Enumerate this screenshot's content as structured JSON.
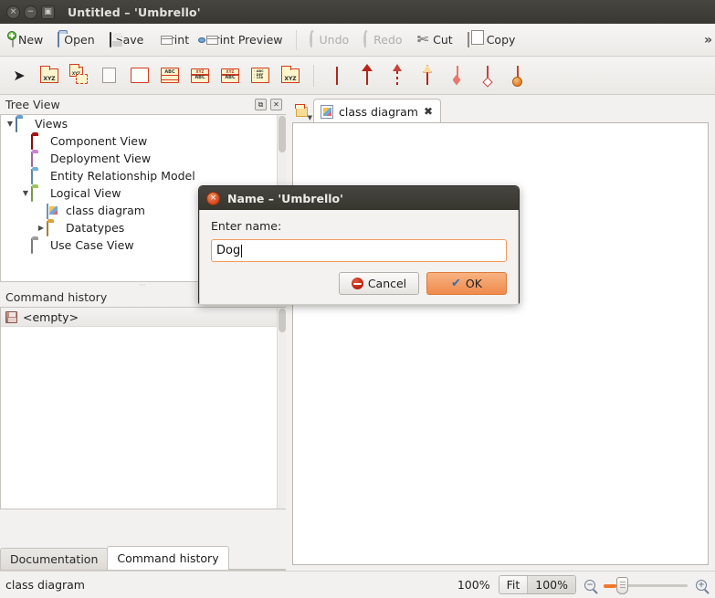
{
  "window": {
    "title": "Untitled – 'Umbrello'",
    "buttons": [
      {
        "name": "close",
        "glyph": "×"
      },
      {
        "name": "minimize",
        "glyph": "−"
      },
      {
        "name": "maximize",
        "glyph": "▣"
      }
    ]
  },
  "toolbar": {
    "items": [
      {
        "label": "New",
        "icon": "new-document-icon",
        "enabled": true
      },
      {
        "label": "Open",
        "icon": "open-folder-icon",
        "enabled": true
      },
      {
        "label": "Save",
        "icon": "floppy-disk-icon",
        "enabled": true
      },
      {
        "label": "Print",
        "icon": "printer-icon",
        "enabled": true
      },
      {
        "label": "Print Preview",
        "icon": "print-preview-icon",
        "enabled": true
      },
      {
        "label": "Undo",
        "icon": "undo-arrow-icon",
        "enabled": false
      },
      {
        "label": "Redo",
        "icon": "redo-arrow-icon",
        "enabled": false
      },
      {
        "label": "Cut",
        "icon": "scissors-icon",
        "enabled": true
      },
      {
        "label": "Copy",
        "icon": "copy-pages-icon",
        "enabled": true
      }
    ],
    "overflow_glyph": "»"
  },
  "uml_toolbar": {
    "items": [
      {
        "name": "select-tool",
        "kind": "cursor"
      },
      {
        "name": "class-tool",
        "kind": "box-fold",
        "text": "XYZ"
      },
      {
        "name": "package-tool",
        "kind": "package"
      },
      {
        "name": "note-tool",
        "kind": "note"
      },
      {
        "name": "box-tool",
        "kind": "plain-box"
      },
      {
        "name": "entity-tool",
        "kind": "abc-box",
        "text": "ABC"
      },
      {
        "name": "interface-tool",
        "kind": "xyz-abc-box",
        "text": "ABC"
      },
      {
        "name": "datatype-tool",
        "kind": "xyz-abc-box2",
        "text": "ABC"
      },
      {
        "name": "enum-tool",
        "kind": "list-box",
        "text": "ABC DEF 138"
      },
      {
        "name": "artifact-tool",
        "kind": "folder-xyz",
        "text": "XYZ"
      },
      {
        "name": "association-tool",
        "kind": "line"
      },
      {
        "name": "generalization-tool",
        "kind": "solid-arrow"
      },
      {
        "name": "dependency-tool",
        "kind": "dashed-arrow"
      },
      {
        "name": "realization-tool",
        "kind": "hollow-arrow"
      },
      {
        "name": "composition-tool",
        "kind": "filled-diamond"
      },
      {
        "name": "aggregation-tool",
        "kind": "hollow-diamond"
      },
      {
        "name": "containment-tool",
        "kind": "circle-end"
      }
    ]
  },
  "tree_panel": {
    "title": "Tree View",
    "title_accel": "T",
    "float_glyph": "⧉",
    "close_glyph": "✕",
    "rows": [
      {
        "label": "Views",
        "indent": 0,
        "arrow": "▼",
        "icon": "views-folder-icon",
        "color": "#6fa8dc"
      },
      {
        "label": "Component View",
        "indent": 1,
        "arrow": "",
        "icon": "component-view-folder-icon",
        "color": "#b31515"
      },
      {
        "label": "Deployment View",
        "indent": 1,
        "arrow": "",
        "icon": "deployment-view-folder-icon",
        "color": "#dd8fe0"
      },
      {
        "label": "Entity Relationship Model",
        "indent": 1,
        "arrow": "",
        "icon": "entity-relationship-folder-icon",
        "color": "#7ec0e8"
      },
      {
        "label": "Logical View",
        "indent": 1,
        "arrow": "▼",
        "icon": "logical-view-folder-icon",
        "color": "#a8d66a"
      },
      {
        "label": "class diagram",
        "indent": 2,
        "arrow": "",
        "icon": "class-diagram-icon",
        "color": "#ffffff"
      },
      {
        "label": "Datatypes",
        "indent": 2,
        "arrow": "▶",
        "icon": "datatypes-folder-icon",
        "color": "#f0b03c"
      },
      {
        "label": "Use Case View",
        "indent": 1,
        "arrow": "",
        "icon": "use-case-view-folder-icon",
        "color": "#adaba6"
      }
    ]
  },
  "command_panel": {
    "title": "Command history",
    "float_glyph": "⧉",
    "close_glyph": "✕",
    "rows": [
      {
        "label": "<empty>",
        "icon": "save-history-icon"
      }
    ]
  },
  "left_tabs": [
    {
      "label": "Documentation",
      "active": false
    },
    {
      "label": "Command history",
      "active": true
    }
  ],
  "document_tabs": {
    "corner_icon": "new-diagram-dropdown-icon",
    "tabs": [
      {
        "label": "class diagram",
        "icon": "class-diagram-icon",
        "close_glyph": "✖",
        "active": true
      }
    ]
  },
  "statusbar": {
    "message": "class diagram",
    "zoom_percent": "100%",
    "fit_label": "Fit",
    "fit_percent": "100%",
    "zoom_out_glyph": "−",
    "zoom_in_glyph": "+",
    "slider_value": 15
  },
  "dialog": {
    "title": "Name – 'Umbrello'",
    "close_glyph": "×",
    "label": "Enter name:",
    "input_value": "Dog",
    "input_placeholder": "",
    "cancel_label": "Cancel",
    "cancel_accel": "C",
    "ok_label": "OK",
    "ok_accel": "O",
    "ok_glyph": "✔"
  },
  "colors": {
    "titlebar": "#3c3b36",
    "accent_orange": "#f0772d",
    "uml_red": "#d23c1f",
    "uml_fill": "#fdf6cd"
  }
}
